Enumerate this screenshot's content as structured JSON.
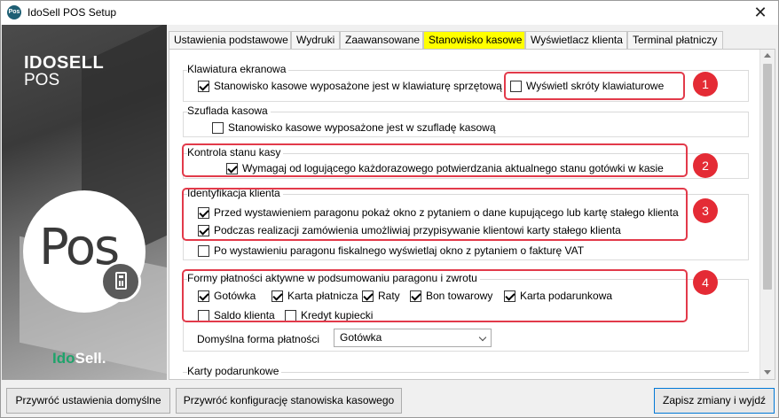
{
  "window": {
    "app_icon_text": "Pos",
    "title": "IdoSell POS Setup",
    "close_symbol": "✕"
  },
  "banner": {
    "brand_top": "IDOSELL",
    "brand_sub": "POS",
    "pos_text": "Pos",
    "logo_prefix": "Ido",
    "logo_suffix": "Sell."
  },
  "tabs": [
    {
      "label": "Ustawienia podstawowe",
      "active": false
    },
    {
      "label": "Wydruki",
      "active": false
    },
    {
      "label": "Zaawansowane",
      "active": false
    },
    {
      "label": "Stanowisko kasowe",
      "active": true
    },
    {
      "label": "Wyświetlacz klienta",
      "active": false
    },
    {
      "label": "Terminal płatniczy",
      "active": false
    }
  ],
  "sections": {
    "keyboard": {
      "title": "Klawiatura ekranowa",
      "opt_hw_keyboard": "Stanowisko kasowe wyposażone jest w klawiaturę sprzętową",
      "opt_shortcuts": "Wyświetl skróty klawiaturowe"
    },
    "drawer": {
      "title": "Szuflada kasowa",
      "opt_drawer": "Stanowisko kasowe wyposażone jest w szufladę kasową"
    },
    "cash_control": {
      "title": "Kontrola stanu kasy",
      "opt_confirm": "Wymagaj od logującego każdorazowego potwierdzania aktualnego stanu gotówki w kasie"
    },
    "client_id": {
      "title": "Identyfikacja klienta",
      "opt_ask_before": "Przed wystawieniem paragonu pokaż okno z pytaniem o dane kupującego lub kartę stałego klienta",
      "opt_assign_loyalty": "Podczas realizacji zamówienia umożliwiaj przypisywanie klientowi karty stałego klienta",
      "opt_vat_invoice": "Po wystawieniu paragonu fiskalnego wyświetlaj okno z pytaniem o fakturę VAT"
    },
    "payments": {
      "title": "Formy płatności aktywne w podsumowaniu paragonu i zwrotu",
      "methods": [
        {
          "label": "Gotówka",
          "checked": true
        },
        {
          "label": "Karta płatnicza",
          "checked": true
        },
        {
          "label": "Raty",
          "checked": true
        },
        {
          "label": "Bon towarowy",
          "checked": true
        },
        {
          "label": "Karta podarunkowa",
          "checked": true
        },
        {
          "label": "Saldo klienta",
          "checked": false
        },
        {
          "label": "Kredyt kupiecki",
          "checked": false
        }
      ],
      "default_label": "Domyślna forma płatności",
      "default_value": "Gotówka"
    },
    "gift_cards": {
      "title": "Karty podarunkowe"
    }
  },
  "annotations": [
    "1",
    "2",
    "3",
    "4"
  ],
  "buttons": {
    "restore_defaults": "Przywróć ustawienia domyślne",
    "restore_station": "Przywróć konfigurację stanowiska kasowego",
    "save_exit": "Zapisz zmiany i wyjdź"
  },
  "colors": {
    "active_tab": "#ffff00",
    "annotation": "#e42b35",
    "brand_green": "#1fa36b"
  }
}
